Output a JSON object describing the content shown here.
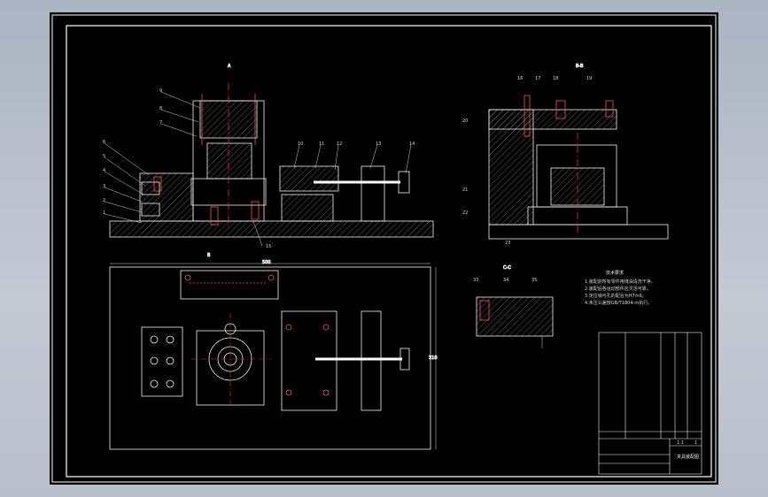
{
  "drawing": {
    "colors": {
      "background": "#000000",
      "frame": "#ffffff",
      "part_outline": "#f2f2f2",
      "centerline": "#ff2a2a",
      "hatch": "#bfbfbf",
      "bolt": "#ff5555",
      "viewport_bg": "#b3bcc8"
    },
    "view_labels": {
      "main": "A",
      "side": "B-B",
      "top": "B",
      "detail": "C-C"
    },
    "main_view_balloons": [
      "9",
      "8",
      "7",
      "6",
      "5",
      "4",
      "3",
      "2",
      "1",
      "10",
      "11",
      "12",
      "13",
      "14",
      "15"
    ],
    "side_view_balloons": [
      "16",
      "17",
      "18",
      "19",
      "20",
      "21",
      "22",
      "23"
    ],
    "detail_balloons": [
      "33",
      "34",
      "35"
    ],
    "dimensions": {
      "top_width": "500",
      "top_height": "310"
    },
    "tech_requirements": {
      "title": "技术要求",
      "items": [
        "1.装配前所有零件用煤油清洗干净。",
        "2.装配后各运动部件应灵活可靠。",
        "3.定位销与孔的配合为H7/n6。",
        "4.未注公差按GB/T1804-m执行。"
      ]
    },
    "title_block": {
      "drawing_name": "夹具装配图",
      "company": "",
      "scale": "1:1",
      "sheet": "1"
    }
  }
}
